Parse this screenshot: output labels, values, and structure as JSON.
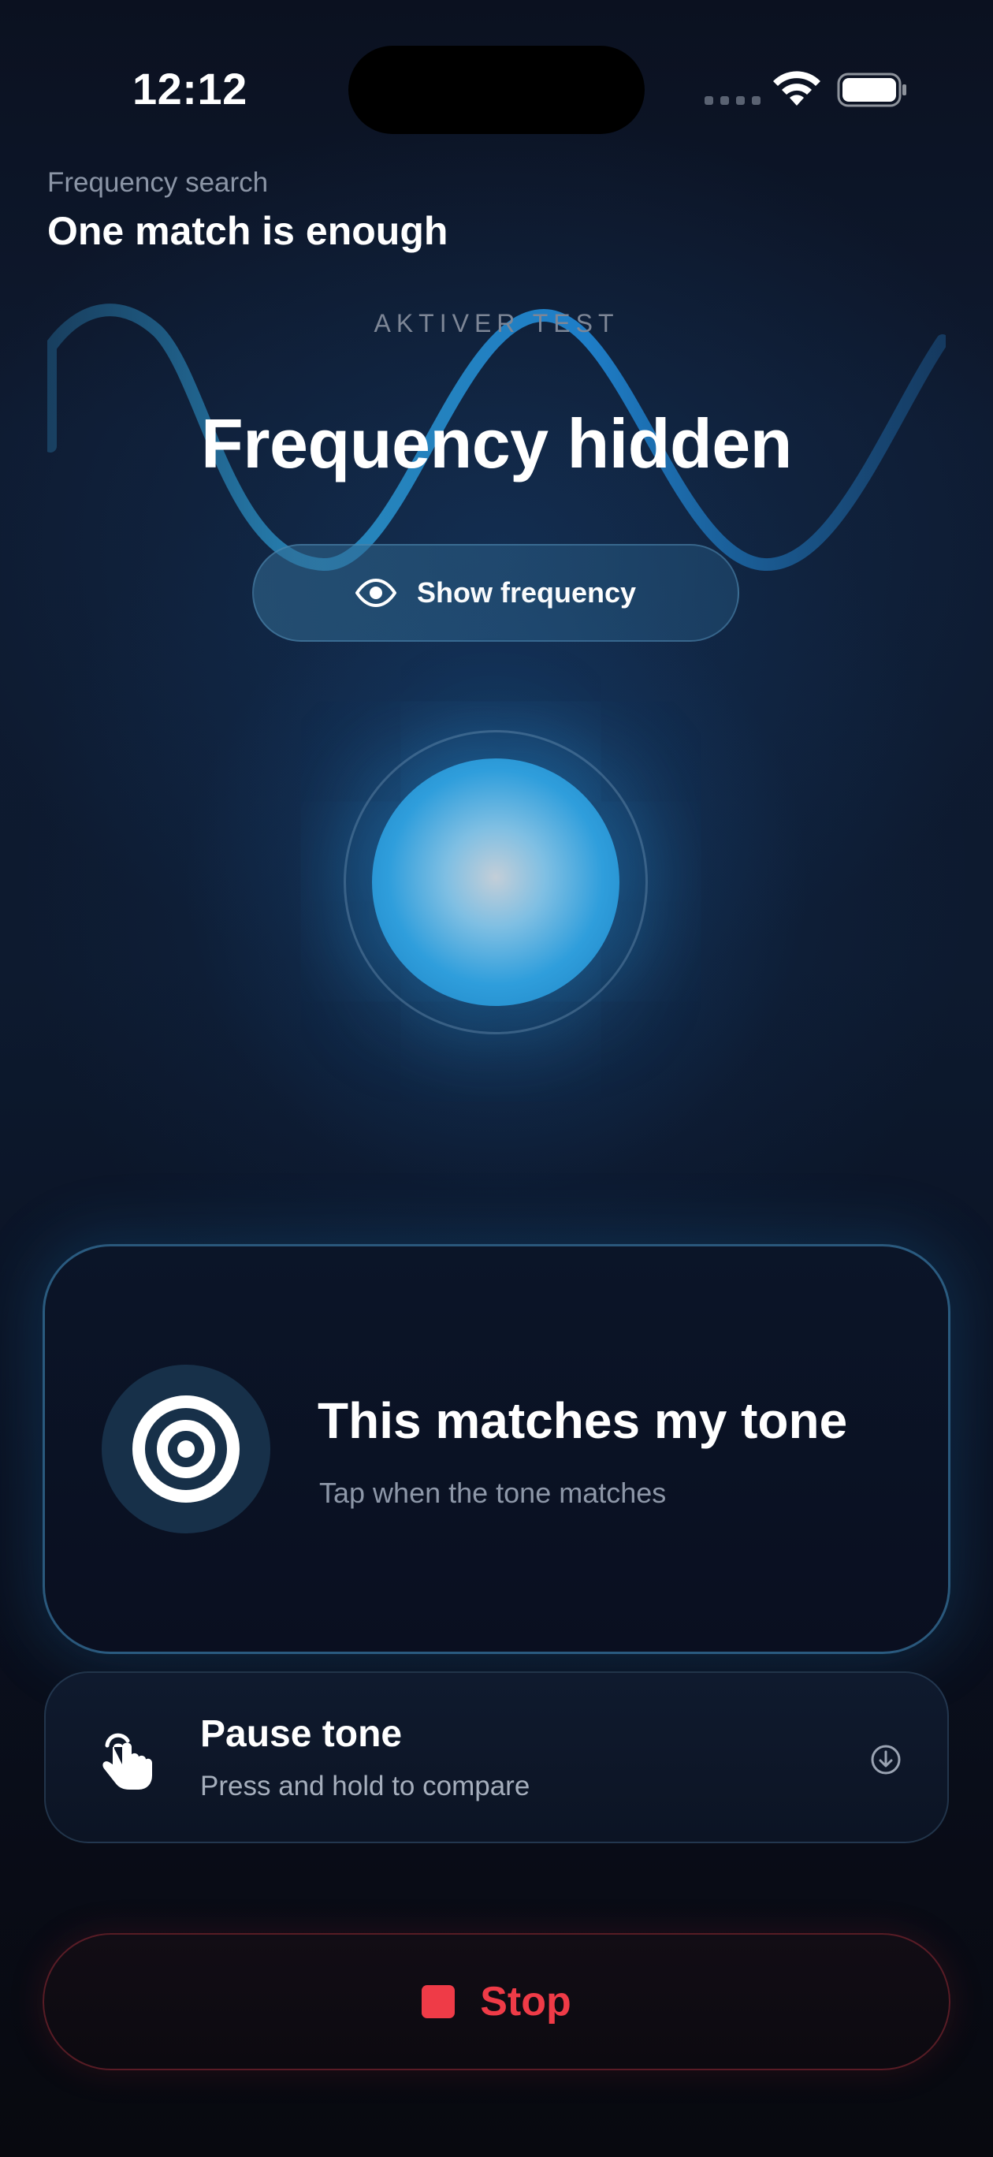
{
  "status_bar": {
    "time": "12:12"
  },
  "header": {
    "subtitle": "Frequency search",
    "title": "One match is enough"
  },
  "test": {
    "eyebrow": "AKTIVER TEST",
    "frequency_title": "Frequency hidden",
    "show_frequency_label": "Show frequency"
  },
  "match_card": {
    "title": "This matches my tone",
    "subtitle": "Tap when the tone matches"
  },
  "pause_card": {
    "title": "Pause tone",
    "subtitle": "Press and hold to compare"
  },
  "stop_button": {
    "label": "Stop"
  },
  "icons": {
    "signal": "cellular-signal-icon",
    "wifi": "wifi-icon",
    "battery": "battery-icon",
    "eye": "eye-icon",
    "target": "target-icon",
    "hand": "hand-press-icon",
    "indicator": "arrow-down-circle-icon",
    "stop": "stop-square-icon"
  },
  "colors": {
    "accent_blue": "#2f9edc",
    "stop_red": "#ef3b47",
    "background": "#0a0f1d"
  }
}
